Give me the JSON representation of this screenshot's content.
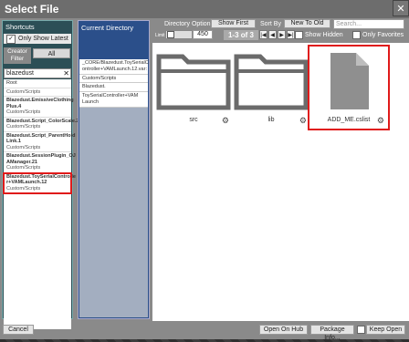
{
  "window": {
    "title": "Select File",
    "close_glyph": "✕"
  },
  "shortcuts": {
    "heading": "Shortcuts",
    "only_show_latest": "Only Show Latest",
    "creator_filter": "Creator Filter",
    "creator_all": "All",
    "search_value": "blazedust",
    "clear_glyph": "✕",
    "items": [
      {
        "name": "Root",
        "path": ""
      },
      {
        "name": "",
        "path": "Custom/Scripts"
      },
      {
        "name": "Blazedust.EmissiveClothing Plus.4",
        "path": "Custom/Scripts"
      },
      {
        "name": "Blazedust.Script_ColorScale.2",
        "path": "Custom/Scripts"
      },
      {
        "name": "Blazedust.Script_ParentHold Link.1",
        "path": "Custom/Scripts"
      },
      {
        "name": "Blazedust.SessionPlugin_OJ AManager.21",
        "path": "Custom/Scripts"
      },
      {
        "name": "Blazedust.ToySerialControlle r+VAMLaunch.12",
        "path": "Custom/Scripts"
      }
    ]
  },
  "current_directory": {
    "heading": "Current Directory",
    "items": [
      "_CORE/Blazedust.ToySerialC ontroller+VAMLaunch.12.var:",
      "Custom/Scripts",
      "Blazedust.",
      "ToySerialController+VAM Launch"
    ]
  },
  "toolbar": {
    "directory_option": "Directory Option",
    "show_first": "Show First",
    "sort_by": "Sort By",
    "sort_value": "New To Old",
    "search_placeholder": "Search...",
    "limit_label": "Limit",
    "limit_value": "450",
    "page_counter": "1-3 of 3",
    "show_hidden": "Show Hidden",
    "only_favorites": "Only Favorites",
    "nav_first": "|◀",
    "nav_prev": "◀",
    "nav_next": "▶",
    "nav_last": "▶|"
  },
  "files": [
    {
      "name": "src",
      "icon": "folder-icon"
    },
    {
      "name": "lib",
      "icon": "folder-icon"
    },
    {
      "name": "ADD_ME.cslist",
      "icon": "file-icon"
    }
  ],
  "bottom": {
    "cancel": "Cancel",
    "open_on_hub": "Open On Hub",
    "package_info": "Package Info...",
    "keep_open": "Keep Open"
  }
}
